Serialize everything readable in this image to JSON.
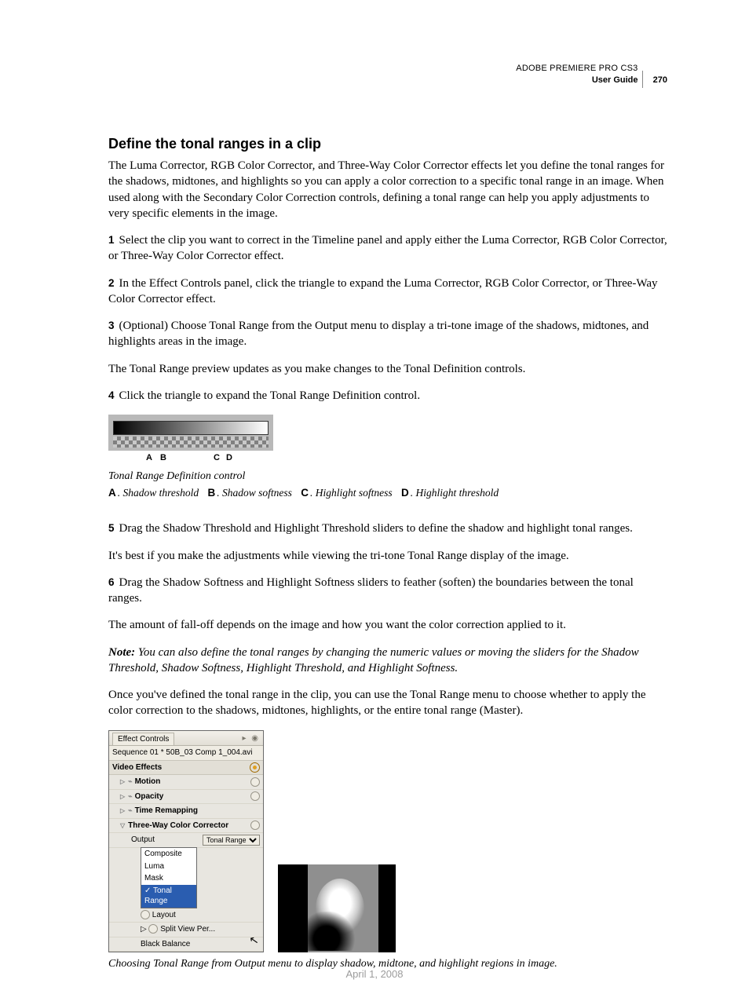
{
  "header": {
    "product": "ADOBE PREMIERE PRO CS3",
    "doc": "User Guide",
    "page": "270"
  },
  "title": "Define the tonal ranges in a clip",
  "intro": "The Luma Corrector, RGB Color Corrector, and Three-Way Color Corrector effects let you define the tonal ranges for the shadows, midtones, and highlights so you can apply a color correction to a specific tonal range in an image. When used along with the Secondary Color Correction controls, defining a tonal range can help you apply adjustments to very specific elements in the image.",
  "steps": {
    "s1": "Select the clip you want to correct in the Timeline panel and apply either the Luma Corrector, RGB Color Corrector, or Three-Way Color Corrector effect.",
    "s2": "In the Effect Controls panel, click the triangle to expand the Luma Corrector, RGB Color Corrector, or Three-Way Color Corrector effect.",
    "s3": "(Optional) Choose Tonal Range from the Output menu to display a tri-tone image of the shadows, midtones, and highlights areas in the image.",
    "s3_after": "The Tonal Range preview updates as you make changes to the Tonal Definition controls.",
    "s4": "Click the triangle to expand the Tonal Range Definition control.",
    "s5": "Drag the Shadow Threshold and Highlight Threshold sliders to define the shadow and highlight tonal ranges.",
    "s5_after": "It's best if you make the adjustments while viewing the tri-tone Tonal Range display of the image.",
    "s6": "Drag the Shadow Softness and Highlight Softness sliders to feather (soften) the boundaries between the tonal ranges.",
    "s6_after": "The amount of fall-off depends on the image and how you want the color correction applied to it."
  },
  "nums": {
    "n1": "1",
    "n2": "2",
    "n3": "3",
    "n4": "4",
    "n5": "5",
    "n6": "6"
  },
  "fig1": {
    "caption": "Tonal Range Definition control",
    "labels": {
      "A": "A",
      "B": "B",
      "C": "C",
      "D": "D"
    },
    "legend": {
      "A": "Shadow threshold",
      "B": "Shadow softness",
      "C": "Highlight softness",
      "D": "Highlight threshold"
    }
  },
  "note": {
    "label": "Note:",
    "text": "You can also define the tonal ranges by changing the numeric values or moving the sliders for the Shadow Threshold, Shadow Softness, Highlight Threshold, and Highlight Softness."
  },
  "after_note": "Once you've defined the tonal range in the clip, you can use the Tonal Range menu to choose whether to apply the color correction to the shadows, midtones, highlights, or the entire tonal range (Master).",
  "panel": {
    "tab": "Effect Controls",
    "sequence": "Sequence 01 * 50B_03 Comp 1_004.avi",
    "section": "Video Effects",
    "rows": {
      "motion": "Motion",
      "opacity": "Opacity",
      "time": "Time Remapping",
      "tw": "Three-Way Color Corrector",
      "output": "Output",
      "output_value": "Tonal Range",
      "layout": "Layout",
      "split": "Split View Per...",
      "black": "Black Balance"
    },
    "menu": {
      "composite": "Composite",
      "luma": "Luma",
      "mask": "Mask",
      "tonal": "Tonal Range"
    }
  },
  "fig2_caption": "Choosing Tonal Range from Output menu to display shadow, midtone, and highlight regions in image.",
  "footer_date": "April 1, 2008"
}
